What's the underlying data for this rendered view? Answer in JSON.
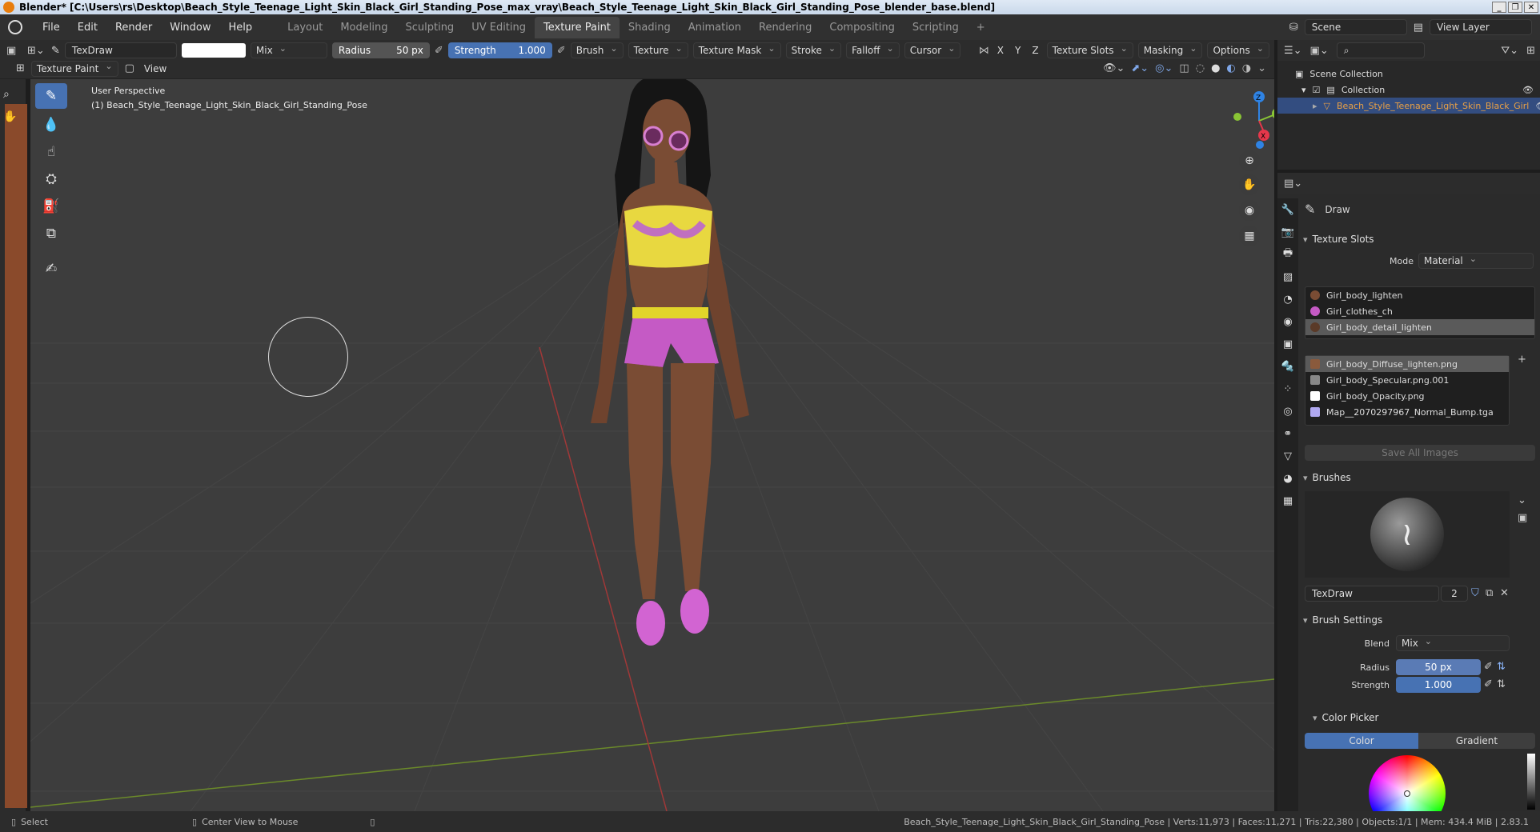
{
  "window": {
    "title": "Blender* [C:\\Users\\rs\\Desktop\\Beach_Style_Teenage_Light_Skin_Black_Girl_Standing_Pose_max_vray\\Beach_Style_Teenage_Light_Skin_Black_Girl_Standing_Pose_blender_base.blend]"
  },
  "menu": [
    "File",
    "Edit",
    "Render",
    "Window",
    "Help"
  ],
  "workspaces": [
    "Layout",
    "Modeling",
    "Sculpting",
    "UV Editing",
    "Texture Paint",
    "Shading",
    "Animation",
    "Rendering",
    "Compositing",
    "Scripting"
  ],
  "active_workspace": "Texture Paint",
  "scene": {
    "name": "Scene",
    "view_layer": "View Layer"
  },
  "tool_header": {
    "brush_name": "TexDraw",
    "blend": "Mix",
    "radius_label": "Radius",
    "radius_value": "50 px",
    "strength_label": "Strength",
    "strength_value": "1.000",
    "menus": [
      "Brush",
      "Texture",
      "Texture Mask",
      "Stroke",
      "Falloff",
      "Cursor"
    ],
    "axes": [
      "X",
      "Y",
      "Z"
    ],
    "right_menus": [
      "Texture Slots",
      "Masking",
      "Options"
    ]
  },
  "header2": {
    "mode": "Texture Paint",
    "view": "View"
  },
  "viewport": {
    "perspective": "User Perspective",
    "object_label": "(1) Beach_Style_Teenage_Light_Skin_Black_Girl_Standing_Pose"
  },
  "gizmo": {
    "z": "Z",
    "y": "Y",
    "x": "X"
  },
  "outliner": {
    "scene_collection": "Scene Collection",
    "collection": "Collection",
    "object": "Beach_Style_Teenage_Light_Skin_Black_Girl"
  },
  "properties": {
    "tool": "Draw",
    "texture_slots_title": "Texture Slots",
    "mode_label": "Mode",
    "mode_value": "Material",
    "materials": [
      "Girl_body_lighten",
      "Girl_clothes_ch",
      "Girl_body_detail_lighten"
    ],
    "images": [
      "Girl_body_Diffuse_lighten.png",
      "Girl_body_Specular.png.001",
      "Girl_body_Opacity.png",
      "Map__2070297967_Normal_Bump.tga"
    ],
    "save_all": "Save All Images",
    "brushes_title": "Brushes",
    "brush_name": "TexDraw",
    "brush_users": "2",
    "brush_settings_title": "Brush Settings",
    "blend_label": "Blend",
    "blend_value": "Mix",
    "radius_label": "Radius",
    "radius_value": "50 px",
    "strength_label": "Strength",
    "strength_value": "1.000",
    "color_picker_title": "Color Picker",
    "color_tab": "Color",
    "gradient_tab": "Gradient"
  },
  "status": {
    "select": "Select",
    "center": "Center View to Mouse",
    "info": "Beach_Style_Teenage_Light_Skin_Black_Girl_Standing_Pose | Verts:11,973 | Faces:11,271 | Tris:22,380 | Objects:1/1 | Mem: 434.4 MiB | 2.83.1"
  },
  "colors": {
    "accent": "#4772b3",
    "viewport": "#3d3d3d",
    "axis_x": "#e6374b",
    "axis_y": "#8ac535",
    "axis_z": "#2f83e4"
  }
}
